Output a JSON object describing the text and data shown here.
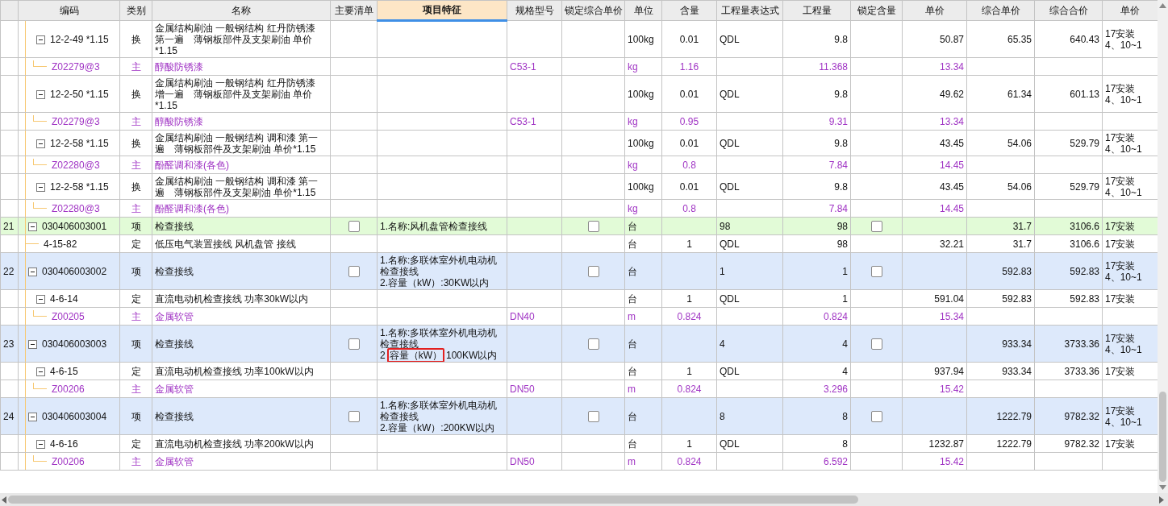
{
  "table": {
    "columns": [
      {
        "label": "编码",
        "selected": false
      },
      {
        "label": "类别",
        "selected": false
      },
      {
        "label": "名称",
        "selected": false
      },
      {
        "label": "主要清单",
        "selected": false
      },
      {
        "label": "项目特征",
        "selected": true
      },
      {
        "label": "规格型号",
        "selected": false
      },
      {
        "label": "锁定综合单价",
        "selected": false
      },
      {
        "label": "单位",
        "selected": false
      },
      {
        "label": "含量",
        "selected": false
      },
      {
        "label": "工程量表达式",
        "selected": false
      },
      {
        "label": "工程量",
        "selected": false
      },
      {
        "label": "锁定含量",
        "selected": false
      },
      {
        "label": "单价",
        "selected": false
      },
      {
        "label": "综合单价",
        "selected": false
      },
      {
        "label": "综合合价",
        "selected": false
      },
      {
        "label": "单价",
        "selected": false
      }
    ],
    "rows": [
      {
        "children": [
          {
            "kind": "quota",
            "selected": false,
            "expanded": true,
            "code": "12-2-49 *1.15",
            "type": "换",
            "name": "金属结构刷油 一般钢结构 红丹防锈漆第一遍　薄钢板部件及支架刷油 单价*1.15",
            "unit": "100kg",
            "content": "0.01",
            "qty_expr": "QDL",
            "qty": "9.8",
            "price": "50.87",
            "unit_price": "65.35",
            "total": "640.43",
            "basis": [
              "17安装",
              "4、10~1"
            ],
            "children": [
              {
                "kind": "material",
                "selected": false,
                "code": "Z02279@3",
                "type": "主",
                "name": "醇酸防锈漆",
                "spec": "C53-1",
                "unit": "kg",
                "content": "1.16",
                "qty": "11.368",
                "price": "13.34"
              }
            ]
          },
          {
            "kind": "quota",
            "selected": false,
            "expanded": true,
            "code": "12-2-50 *1.15",
            "type": "换",
            "name": "金属结构刷油 一般钢结构 红丹防锈漆增一遍　薄钢板部件及支架刷油 单价*1.15",
            "unit": "100kg",
            "content": "0.01",
            "qty_expr": "QDL",
            "qty": "9.8",
            "price": "49.62",
            "unit_price": "61.34",
            "total": "601.13",
            "basis": [
              "17安装",
              "4、10~1"
            ],
            "children": [
              {
                "kind": "material",
                "selected": false,
                "code": "Z02279@3",
                "type": "主",
                "name": "醇酸防锈漆",
                "spec": "C53-1",
                "unit": "kg",
                "content": "0.95",
                "qty": "9.31",
                "price": "13.34"
              }
            ]
          },
          {
            "kind": "quota",
            "selected": false,
            "expanded": true,
            "code": "12-2-58 *1.15",
            "type": "换",
            "name": "金属结构刷油 一般钢结构 调和漆 第一遍　薄钢板部件及支架刷油 单价*1.15",
            "unit": "100kg",
            "content": "0.01",
            "qty_expr": "QDL",
            "qty": "9.8",
            "price": "43.45",
            "unit_price": "54.06",
            "total": "529.79",
            "basis": [
              "17安装",
              "4、10~1"
            ],
            "children": [
              {
                "kind": "material",
                "selected": false,
                "code": "Z02280@3",
                "type": "主",
                "name": "酚醛调和漆(各色)",
                "unit": "kg",
                "content": "0.8",
                "qty": "7.84",
                "price": "14.45"
              }
            ]
          },
          {
            "kind": "quota",
            "selected": false,
            "expanded": true,
            "code": "12-2-58 *1.15",
            "type": "换",
            "name": "金属结构刷油 一般钢结构 调和漆 第一遍　薄钢板部件及支架刷油 单价*1.15",
            "unit": "100kg",
            "content": "0.01",
            "qty_expr": "QDL",
            "qty": "9.8",
            "price": "43.45",
            "unit_price": "54.06",
            "total": "529.79",
            "basis": [
              "17安装",
              "4、10~1"
            ],
            "children": [
              {
                "kind": "material",
                "selected": false,
                "code": "Z02280@3",
                "type": "主",
                "name": "酚醛调和漆(各色)",
                "unit": "kg",
                "content": "0.8",
                "qty": "7.84",
                "price": "14.45"
              }
            ]
          }
        ]
      },
      {
        "kind": "item",
        "selected": true,
        "expanded": true,
        "index": "21",
        "code": "030406003001",
        "type": "项",
        "name": "检查接线",
        "main_list": false,
        "feature": [
          [
            {
              "text": "1.名称:风机盘管检查接线"
            }
          ]
        ],
        "lock_unit_price": false,
        "unit": "台",
        "qty_expr": "98",
        "qty": "98",
        "lock_content": false,
        "unit_price": "31.7",
        "total": "3106.6",
        "basis": [
          "17安装"
        ],
        "children": [
          {
            "kind": "quota",
            "selected": false,
            "code": "4-15-82",
            "type": "定",
            "name": "低压电气装置接线 风机盘管 接线",
            "unit": "台",
            "content": "1",
            "qty_expr": "QDL",
            "qty": "98",
            "price": "32.21",
            "unit_price": "31.7",
            "total": "3106.6",
            "basis": [
              "17安装"
            ]
          }
        ]
      },
      {
        "kind": "item",
        "selected": false,
        "expanded": true,
        "index": "22",
        "code": "030406003002",
        "type": "项",
        "name": "检查接线",
        "main_list": false,
        "feature": [
          [
            {
              "text": "1.名称:多联体室外机电动机检查接线"
            }
          ],
          [
            {
              "text": "2.容量（kW）:30KW以内"
            }
          ]
        ],
        "lock_unit_price": false,
        "unit": "台",
        "qty_expr": "1",
        "qty": "1",
        "lock_content": false,
        "unit_price": "592.83",
        "total": "592.83",
        "basis": [
          "17安装",
          "4、10~1"
        ],
        "children": [
          {
            "kind": "quota",
            "selected": false,
            "expanded": true,
            "code": "4-6-14",
            "type": "定",
            "name": "直流电动机检查接线 功率30kW以内",
            "unit": "台",
            "content": "1",
            "qty_expr": "QDL",
            "qty": "1",
            "price": "591.04",
            "unit_price": "592.83",
            "total": "592.83",
            "basis": [
              "17安装"
            ],
            "children": [
              {
                "kind": "material",
                "selected": false,
                "code": "Z00205",
                "type": "主",
                "name": "金属软管",
                "spec": "DN40",
                "unit": "m",
                "content": "0.824",
                "qty": "0.824",
                "price": "15.34"
              }
            ]
          }
        ]
      },
      {
        "kind": "item",
        "selected": false,
        "expanded": true,
        "index": "23",
        "code": "030406003003",
        "type": "项",
        "name": "检查接线",
        "main_list": false,
        "feature": [
          [
            {
              "text": "1.名称:多联体室外机电动机检查接线"
            }
          ],
          [
            {
              "text": "2"
            },
            {
              "text": "容量（kW）",
              "boxed": true
            },
            {
              "text": "100KW以内"
            }
          ]
        ],
        "lock_unit_price": false,
        "unit": "台",
        "qty_expr": "4",
        "qty": "4",
        "lock_content": false,
        "unit_price": "933.34",
        "total": "3733.36",
        "basis": [
          "17安装",
          "4、10~1"
        ],
        "children": [
          {
            "kind": "quota",
            "selected": false,
            "expanded": true,
            "code": "4-6-15",
            "type": "定",
            "name": "直流电动机检查接线 功率100kW以内",
            "unit": "台",
            "content": "1",
            "qty_expr": "QDL",
            "qty": "4",
            "price": "937.94",
            "unit_price": "933.34",
            "total": "3733.36",
            "basis": [
              "17安装"
            ],
            "children": [
              {
                "kind": "material",
                "selected": false,
                "code": "Z00206",
                "type": "主",
                "name": "金属软管",
                "spec": "DN50",
                "unit": "m",
                "content": "0.824",
                "qty": "3.296",
                "price": "15.42"
              }
            ]
          }
        ]
      },
      {
        "kind": "item",
        "selected": false,
        "expanded": true,
        "index": "24",
        "code": "030406003004",
        "type": "项",
        "name": "检查接线",
        "main_list": false,
        "feature": [
          [
            {
              "text": "1.名称:多联体室外机电动机检查接线"
            }
          ],
          [
            {
              "text": "2.容量（kW）:200KW以内"
            }
          ]
        ],
        "lock_unit_price": false,
        "unit": "台",
        "qty_expr": "8",
        "qty": "8",
        "lock_content": false,
        "unit_price": "1222.79",
        "total": "9782.32",
        "basis": [
          "17安装",
          "4、10~1"
        ],
        "children": [
          {
            "kind": "quota",
            "selected": false,
            "expanded": true,
            "code": "4-6-16",
            "type": "定",
            "name": "直流电动机检查接线 功率200kW以内",
            "unit": "台",
            "content": "1",
            "qty_expr": "QDL",
            "qty": "8",
            "price": "1232.87",
            "unit_price": "1222.79",
            "total": "9782.32",
            "basis": [
              "17安装"
            ],
            "children": [
              {
                "kind": "material",
                "selected": false,
                "code": "Z00206",
                "type": "主",
                "name": "金属软管",
                "spec": "DN50",
                "unit": "m",
                "content": "0.824",
                "qty": "6.592",
                "price": "15.42"
              }
            ]
          }
        ]
      }
    ]
  }
}
